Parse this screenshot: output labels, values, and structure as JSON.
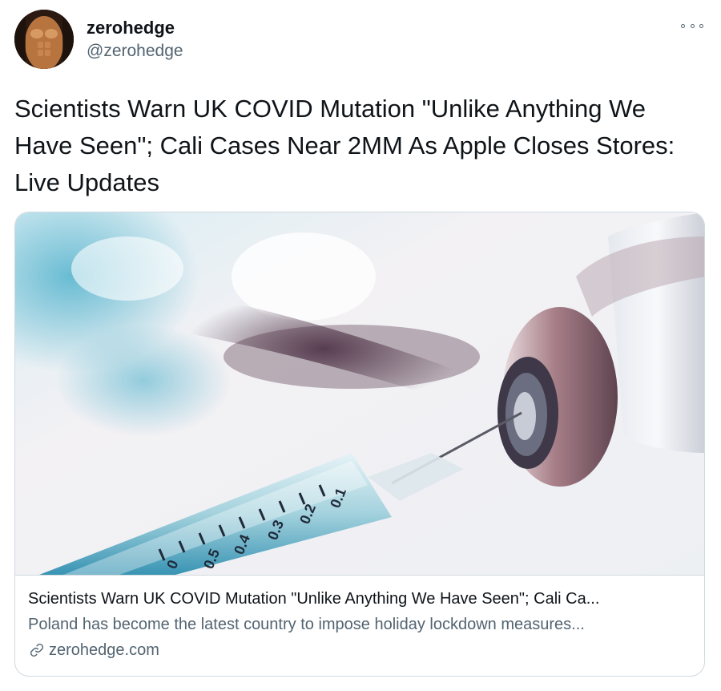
{
  "author": {
    "display_name": "zerohedge",
    "handle": "@zerohedge"
  },
  "tweet": {
    "text": "Scientists Warn UK COVID Mutation \"Unlike Anything We Have Seen\"; Cali Cases Near 2MM As Apple Closes Stores: Live Updates"
  },
  "card": {
    "title": "Scientists Warn UK COVID Mutation \"Unlike Anything We Have Seen\"; Cali Ca...",
    "description": "Poland has become the latest country to impose holiday lockdown measures...",
    "domain": "zerohedge.com",
    "image_subject": "syringe-and-vaccine-vial",
    "syringe_scale": [
      "0.1",
      "0.2",
      "0.3",
      "0.4",
      "0.5",
      "0"
    ]
  },
  "icons": {
    "more": "more-options-icon",
    "link": "link-icon"
  },
  "colors": {
    "text_primary": "#0f1419",
    "text_secondary": "#536471",
    "card_border": "#cfd9de"
  }
}
